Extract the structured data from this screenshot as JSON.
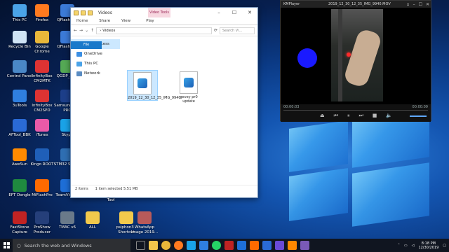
{
  "desktop_icons": [
    {
      "label": "This PC",
      "color": "#4aa3e8"
    },
    {
      "label": "Firefox",
      "color": "#ff7a1f"
    },
    {
      "label": "QFlashTool",
      "color": "#3c7bd8"
    },
    {
      "label": "Recycle Bin",
      "color": "#cfe4f5"
    },
    {
      "label": "Google Chrome",
      "color": "#e8b73a"
    },
    {
      "label": "QFlashTool",
      "color": "#3c7bd8"
    },
    {
      "label": "Control Panel",
      "color": "#4a88c7"
    },
    {
      "label": "InfinityBox CM2MTK",
      "color": "#d33"
    },
    {
      "label": "QGDP_As...",
      "color": "#55aa55"
    },
    {
      "label": "3uTools",
      "color": "#2f7fe0"
    },
    {
      "label": "InfinityBox CM2SPD",
      "color": "#d33"
    },
    {
      "label": "Samsung Tool PRO",
      "color": "#1d3f8a"
    },
    {
      "label": "AFTool_BBK",
      "color": "#2a6ad6"
    },
    {
      "label": "iTunes",
      "color": "#e95aa8"
    },
    {
      "label": "Skype",
      "color": "#1aa3e8"
    },
    {
      "label": "AweSun",
      "color": "#ff8a00"
    },
    {
      "label": "Kingo ROOT",
      "color": "#1f5fb8"
    },
    {
      "label": "STM32 ST-LI...",
      "color": "#2f6fb3"
    },
    {
      "label": "EFT Dongle",
      "color": "#1f8a3f"
    },
    {
      "label": "MiFlashPro",
      "color": "#ff6a00"
    },
    {
      "label": "TeamViewer",
      "color": "#1e6fd8"
    },
    {
      "label": "FastStone Capture",
      "color": "#c02323"
    },
    {
      "label": "ProShow Producer",
      "color": "#253f7a"
    },
    {
      "label": "TMAC v6",
      "color": "#6a7a8a"
    },
    {
      "label": "ALL",
      "color": "#f2c94c"
    },
    {
      "label": "psiphon3 - Shortcut",
      "color": "#f2c94c"
    },
    {
      "label": "WhatsApp Image 2019...",
      "color": "#b85a5a"
    }
  ],
  "explorer": {
    "title": "Videos",
    "context_tab": "Video Tools",
    "tabs": [
      "File",
      "Home",
      "Share",
      "View",
      "Play"
    ],
    "address": "Videos",
    "search_placeholder": "Search Vi...",
    "nav": [
      "Quick access",
      "OneDrive",
      "This PC",
      "Network"
    ],
    "files": [
      {
        "name": "2019_12_30_12_35_IMG_9940",
        "selected": true
      },
      {
        "name": "gevey pr0 update",
        "selected": false
      }
    ],
    "status": {
      "items": "2 items",
      "selected": "1 item selected  5.51 MB"
    },
    "below_label": "Tool"
  },
  "kmplayer": {
    "app": "KMPlayer",
    "file": "2019_12_30_12_35_IMG_9940.MOV",
    "time_current": "00:00:03",
    "time_total": "00:00:09",
    "progress": 0.33
  },
  "taskbar": {
    "search_placeholder": "Search the web and Windows",
    "time": "8:18 PM",
    "date": "12/30/2019"
  },
  "colors": {
    "accent": "#1979ca",
    "blue_dot": "#1a1aff"
  }
}
